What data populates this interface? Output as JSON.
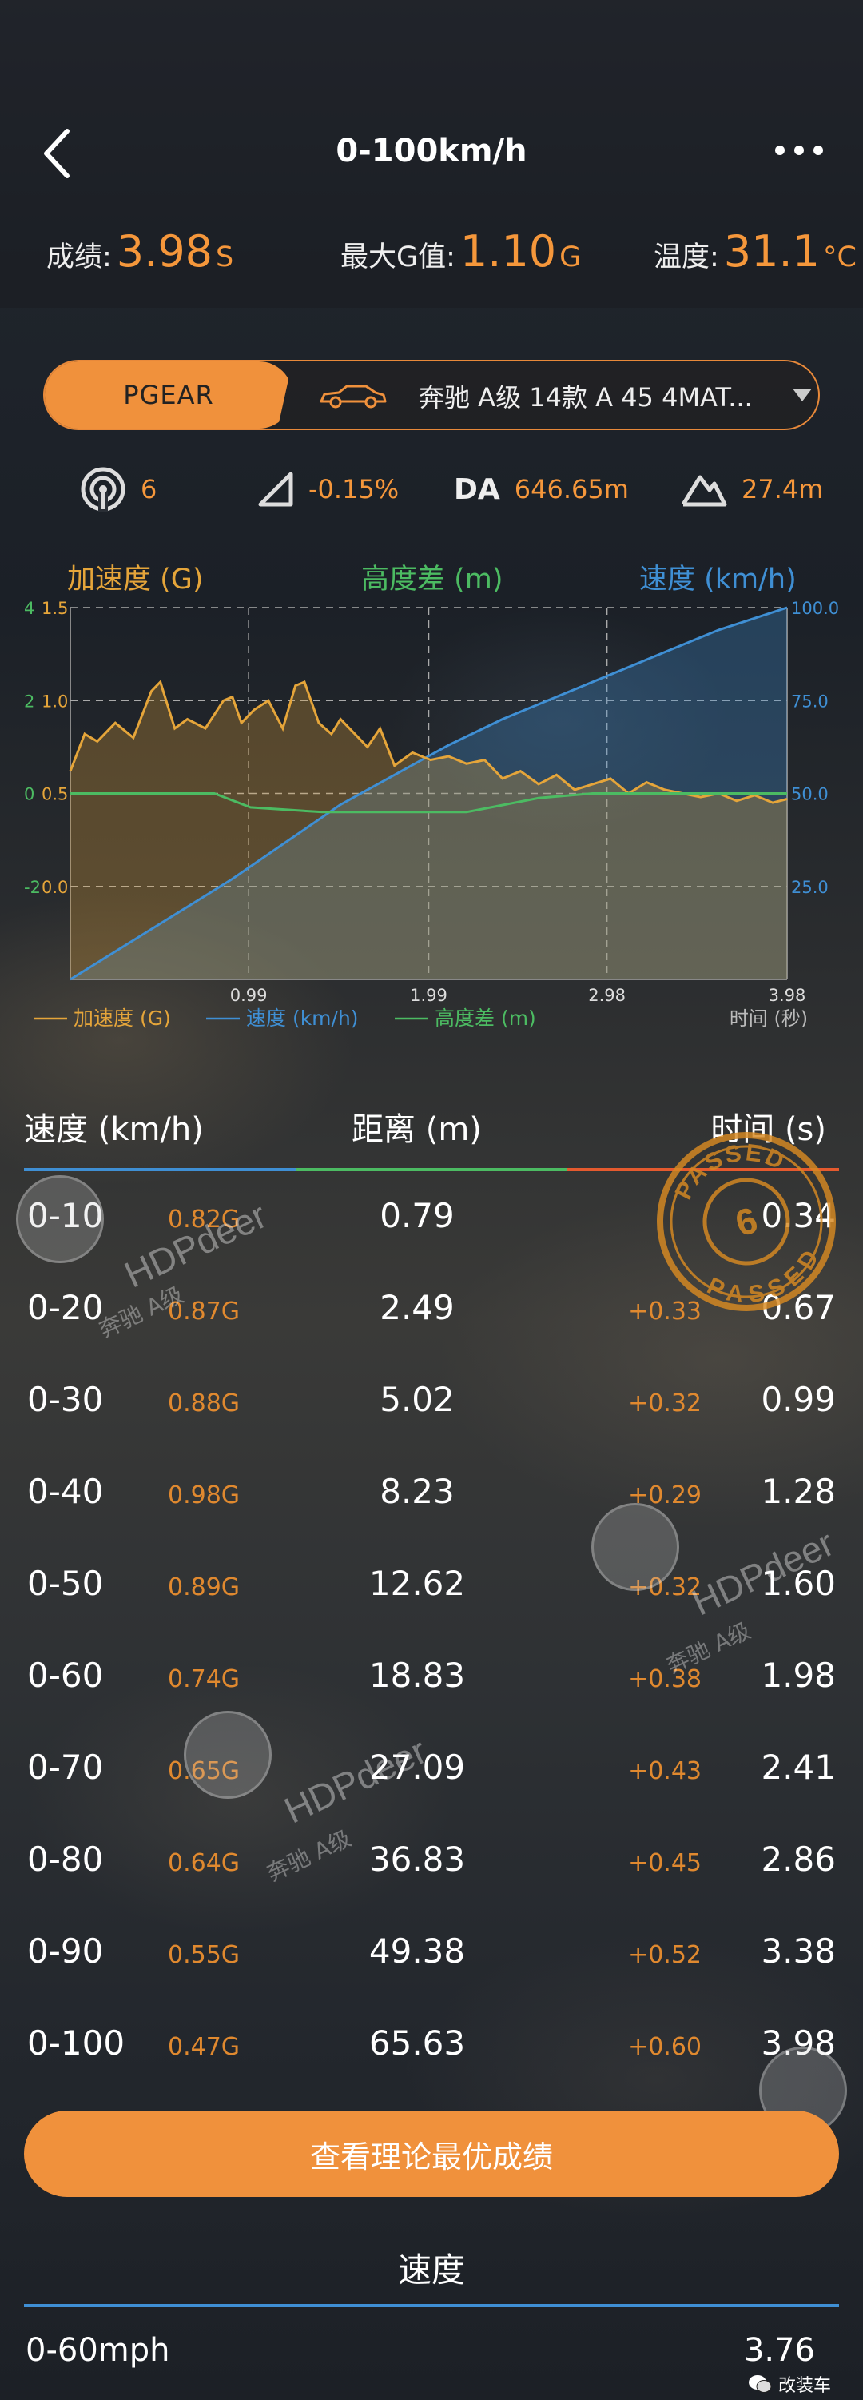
{
  "header": {
    "title": "0-100km/h",
    "stats": [
      {
        "label": "成绩:",
        "value": "3.98",
        "unit": "S"
      },
      {
        "label": "最大G值:",
        "value": "1.10",
        "unit": "G"
      },
      {
        "label": "温度:",
        "value": "31.1",
        "unit": "°C"
      }
    ]
  },
  "selector": {
    "pgear_label": "PGEAR",
    "car_name": "奔驰 A级 14款 A 45 4MAT..."
  },
  "metrics": {
    "satellites": "6",
    "slope": "-0.15%",
    "da_tag": "DA",
    "da_value": "646.65m",
    "altitude": "27.4m"
  },
  "colors": {
    "accent": "#f0913c",
    "accel": "#e5a53a",
    "speed": "#3f8fd4",
    "height": "#4cbb62"
  },
  "chart_data": {
    "type": "line",
    "headers": {
      "accel": "加速度 (G)",
      "height": "高度差 (m)",
      "speed": "速度 (km/h)"
    },
    "left_axis_outer_ticks": [
      "4",
      "2",
      "0",
      "-2"
    ],
    "left_axis_inner_ticks": [
      "1.5",
      "1.0",
      "0.5",
      "0.0"
    ],
    "right_axis_ticks": [
      "100.0",
      "75.0",
      "50.0",
      "25.0"
    ],
    "x_ticks": [
      "0.99",
      "1.99",
      "2.98",
      "3.98"
    ],
    "xlabel": "时间 (秒)",
    "xlim": [
      0,
      3.98
    ],
    "ylim_accel": [
      -0.5,
      1.5
    ],
    "ylim_speed": [
      0,
      100
    ],
    "ylim_height": [
      -4,
      4
    ],
    "legend": [
      "加速度 (G)",
      "速度 (km/h)",
      "高度差 (m)"
    ],
    "series": [
      {
        "name": "速度 (km/h)",
        "axis": "right",
        "x": [
          0,
          0.3,
          0.6,
          0.9,
          1.2,
          1.5,
          1.8,
          2.1,
          2.4,
          2.7,
          3.0,
          3.3,
          3.6,
          3.98
        ],
        "values": [
          0,
          9,
          18,
          27,
          37,
          47,
          55,
          63,
          70,
          76,
          82,
          88,
          94,
          100
        ]
      },
      {
        "name": "加速度 (G)",
        "axis": "left-inner",
        "x": [
          0,
          0.08,
          0.15,
          0.25,
          0.35,
          0.45,
          0.5,
          0.58,
          0.65,
          0.75,
          0.85,
          0.9,
          0.95,
          1.02,
          1.1,
          1.18,
          1.25,
          1.3,
          1.38,
          1.45,
          1.5,
          1.58,
          1.65,
          1.72,
          1.8,
          1.9,
          2.0,
          2.1,
          2.2,
          2.3,
          2.4,
          2.5,
          2.6,
          2.7,
          2.8,
          2.9,
          3.0,
          3.1,
          3.2,
          3.3,
          3.4,
          3.5,
          3.6,
          3.7,
          3.8,
          3.9,
          3.98
        ],
        "values": [
          0.62,
          0.82,
          0.78,
          0.88,
          0.8,
          1.05,
          1.1,
          0.85,
          0.9,
          0.85,
          1.0,
          1.02,
          0.88,
          0.95,
          1.0,
          0.85,
          1.08,
          1.1,
          0.88,
          0.82,
          0.9,
          0.82,
          0.75,
          0.85,
          0.65,
          0.72,
          0.68,
          0.7,
          0.66,
          0.68,
          0.58,
          0.62,
          0.55,
          0.6,
          0.52,
          0.55,
          0.58,
          0.5,
          0.56,
          0.52,
          0.5,
          0.48,
          0.5,
          0.46,
          0.49,
          0.45,
          0.47
        ]
      },
      {
        "name": "高度差 (m)",
        "axis": "left-outer",
        "x": [
          0,
          0.5,
          0.8,
          1.0,
          1.4,
          2.2,
          2.6,
          2.9,
          3.2,
          3.98
        ],
        "values": [
          0,
          0,
          0,
          -0.3,
          -0.4,
          -0.4,
          -0.1,
          0,
          0,
          0
        ]
      }
    ]
  },
  "table": {
    "headers": {
      "speed": "速度 (km/h)",
      "distance": "距离 (m)",
      "time": "时间 (s)"
    },
    "rows": [
      {
        "speed": "0-10",
        "g": "0.82G",
        "distance": "0.79",
        "delta": "",
        "time": "0.34"
      },
      {
        "speed": "0-20",
        "g": "0.87G",
        "distance": "2.49",
        "delta": "+0.33",
        "time": "0.67"
      },
      {
        "speed": "0-30",
        "g": "0.88G",
        "distance": "5.02",
        "delta": "+0.32",
        "time": "0.99"
      },
      {
        "speed": "0-40",
        "g": "0.98G",
        "distance": "8.23",
        "delta": "+0.29",
        "time": "1.28"
      },
      {
        "speed": "0-50",
        "g": "0.89G",
        "distance": "12.62",
        "delta": "+0.32",
        "time": "1.60"
      },
      {
        "speed": "0-60",
        "g": "0.74G",
        "distance": "18.83",
        "delta": "+0.38",
        "time": "1.98"
      },
      {
        "speed": "0-70",
        "g": "0.65G",
        "distance": "27.09",
        "delta": "+0.43",
        "time": "2.41"
      },
      {
        "speed": "0-80",
        "g": "0.64G",
        "distance": "36.83",
        "delta": "+0.45",
        "time": "2.86"
      },
      {
        "speed": "0-90",
        "g": "0.55G",
        "distance": "49.38",
        "delta": "+0.52",
        "time": "3.38"
      },
      {
        "speed": "0-100",
        "g": "0.47G",
        "distance": "65.63",
        "delta": "+0.60",
        "time": "3.98"
      }
    ]
  },
  "stamp": {
    "text": "PASSED",
    "number": "6"
  },
  "watermark": {
    "brand": "HDPdeer",
    "car": "奔驰 A级"
  },
  "best_button": "查看理论最优成绩",
  "section": {
    "title": "速度",
    "row_label": "0-60mph",
    "row_value": "3.76"
  },
  "footer_brand": "改装车"
}
